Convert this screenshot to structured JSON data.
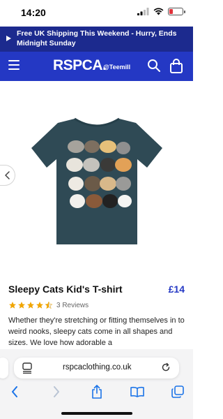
{
  "status_bar": {
    "time": "14:20"
  },
  "promo": {
    "text": "Free UK Shipping This Weekend - Hurry, Ends Midnight Sunday"
  },
  "header": {
    "logo": "RSPCA.",
    "partner_logo": "@Teemill"
  },
  "product": {
    "title": "Sleepy Cats Kid's T-shirt",
    "price": "£14",
    "rating": 4.5,
    "reviews": "3 Reviews",
    "description": "Whether they're stretching or fitting themselves in to weird nooks, sleepy cats come in all shapes and sizes. We love how adorable a",
    "shirt_color": "#2f4a55"
  },
  "browser": {
    "url": "rspcaclothing.co.uk"
  },
  "colors": {
    "brand_blue": "#2438c4",
    "banner_navy": "#1c2a8e",
    "star_gold": "#f0a500",
    "ios_blue": "#1a73e8"
  },
  "icons": {
    "menu": "menu-icon",
    "search": "search-icon",
    "bag": "shopping-bag-icon",
    "prev": "chevron-left-icon",
    "back": "back-icon",
    "forward": "forward-icon",
    "share": "share-icon",
    "bookmarks": "bookmarks-icon",
    "tabs": "tabs-icon",
    "reload": "reload-icon",
    "reader": "reader-icon"
  }
}
